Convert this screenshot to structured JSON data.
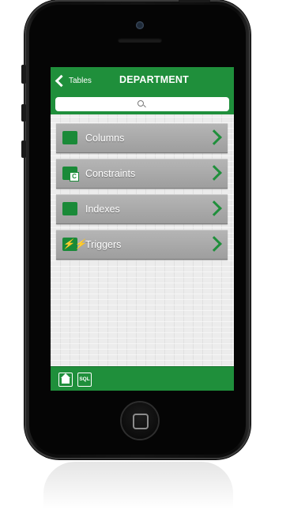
{
  "navbar": {
    "back_label": "Tables",
    "title": "DEPARTMENT"
  },
  "search": {
    "placeholder": "",
    "icon": "search-icon"
  },
  "menu": {
    "items": [
      {
        "label": "Columns",
        "icon": "columns-grid-icon"
      },
      {
        "label": "Constraints",
        "icon": "constraints-icon"
      },
      {
        "label": "Indexes",
        "icon": "indexes-list-icon"
      },
      {
        "label": "Triggers",
        "icon": "triggers-icon"
      }
    ]
  },
  "toolbar": {
    "home_icon": "home-icon",
    "sql_label": "SQL"
  },
  "colors": {
    "accent_green": "#1f8f3b",
    "item_gray": "#a8a8a8"
  }
}
